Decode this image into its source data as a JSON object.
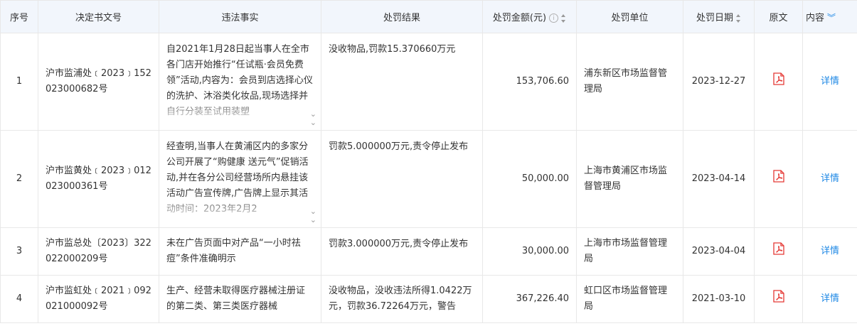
{
  "columns": {
    "index": "序号",
    "doc_no": "决定书文号",
    "facts": "违法事实",
    "result": "处罚结果",
    "amount": "处罚金额(元)",
    "unit": "处罚单位",
    "date": "处罚日期",
    "original": "原文",
    "content": "内容"
  },
  "rows": [
    {
      "index": "1",
      "doc_no": "沪市监浦处﹝2023﹞152023000682号",
      "facts": "自2021年1月28日起当事人在全市各门店开始推行“任试瓶·会员免费领”活动,内容为：会员到店选择心仪的洗护、沐浴类化妆品,现场选择并自行分装至试用装塑",
      "result": "没收物品,罚款15.370660万元",
      "amount": "153,706.60",
      "unit": "浦东新区市场监督管理局",
      "date": "2023-12-27",
      "detail": "详情"
    },
    {
      "index": "2",
      "doc_no": "沪市监黄处﹝2023﹞012023000361号",
      "facts": "经查明,当事人在黄浦区内的多家分公司开展了“购健康 送元气”促销活动,并在各分公司经营场所内悬挂该活动广告宣传牌,广告牌上显示其活动时间：2023年2月2",
      "result": "罚款5.000000万元,责令停止发布",
      "amount": "50,000.00",
      "unit": "上海市黄浦区市场监督管理局",
      "date": "2023-04-14",
      "detail": "详情"
    },
    {
      "index": "3",
      "doc_no": "沪市监总处〔2023〕322022000209号",
      "facts": "未在广告页面中对产品“一小时祛痘”条件准确明示",
      "result": "罚款3.000000万元,责令停止发布",
      "amount": "30,000.00",
      "unit": "上海市市场监督管理局",
      "date": "2023-04-04",
      "detail": "详情"
    },
    {
      "index": "4",
      "doc_no": "沪市监虹处﹝2021﹞092021000092号",
      "facts": "生产、经营未取得医疗器械注册证的第二类、第三类医疗器械",
      "result": "没收物品，没收违法所得1.0422万元，罚款36.72264万元，警告",
      "amount": "367,226.40",
      "unit": "虹口区市场监督管理局",
      "date": "2021-03-10",
      "detail": "详情"
    }
  ],
  "colors": {
    "header_bg": "#f2f6fc",
    "link": "#1e88e5",
    "pdf_red": "#e53935",
    "border": "#e8e8e8"
  },
  "icons": {
    "sort": "sort-icon",
    "info": "info-icon",
    "pdf": "pdf-icon",
    "expand": "expand-chevron-icon",
    "columns": "double-chevron-down-icon"
  }
}
